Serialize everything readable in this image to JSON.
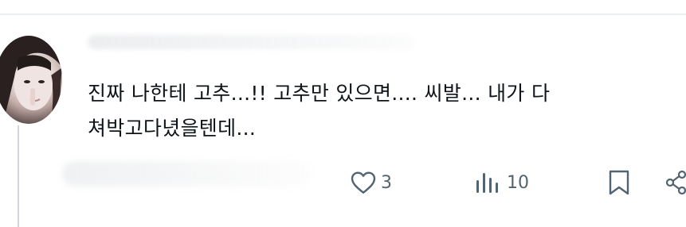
{
  "tweet": {
    "text_line1": "진짜 나한테 고추...!! 고추만 있으면.... 씨발... 내가 다",
    "text_line2": "쳐박고다녔을텐데..."
  },
  "actions": {
    "like": {
      "icon": "heart-icon",
      "count": "3"
    },
    "views": {
      "icon": "bar-chart-icon",
      "count": "10"
    },
    "bookmark": {
      "icon": "bookmark-icon"
    },
    "share": {
      "icon": "share-icon"
    }
  },
  "colors": {
    "text": "#0f1419",
    "icon": "#536471",
    "thread_line": "#d0d6db"
  }
}
